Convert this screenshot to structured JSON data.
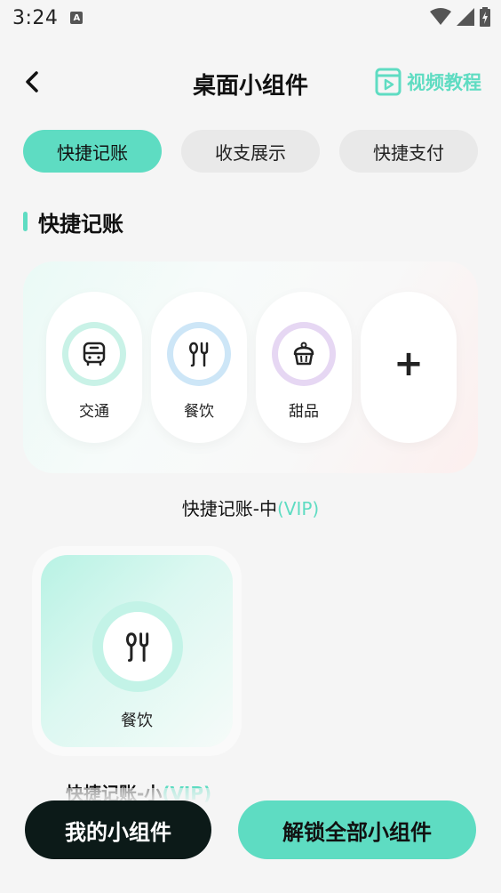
{
  "status_bar": {
    "time": "3:24",
    "notification_letter": "A"
  },
  "header": {
    "title": "桌面小组件",
    "video_tutorial_label": "视频教程"
  },
  "tabs": [
    {
      "label": "快捷记账",
      "active": true
    },
    {
      "label": "收支展示",
      "active": false
    },
    {
      "label": "快捷支付",
      "active": false
    }
  ],
  "section": {
    "title": "快捷记账"
  },
  "medium_widget": {
    "items": [
      {
        "label": "交通",
        "icon": "bus-icon"
      },
      {
        "label": "餐饮",
        "icon": "utensils-icon"
      },
      {
        "label": "甜品",
        "icon": "cupcake-icon"
      }
    ],
    "add_label": "+",
    "caption": "快捷记账-中",
    "caption_tag": "(VIP)"
  },
  "small_widget": {
    "item_label": "餐饮",
    "icon": "utensils-icon",
    "caption": "快捷记账-小",
    "caption_tag": "(VIP)"
  },
  "bottom": {
    "my_widgets_label": "我的小组件",
    "unlock_label": "解锁全部小组件"
  },
  "colors": {
    "accent": "#5edcc2",
    "dark_button": "#0c1a18",
    "background": "#f5f5f5"
  }
}
